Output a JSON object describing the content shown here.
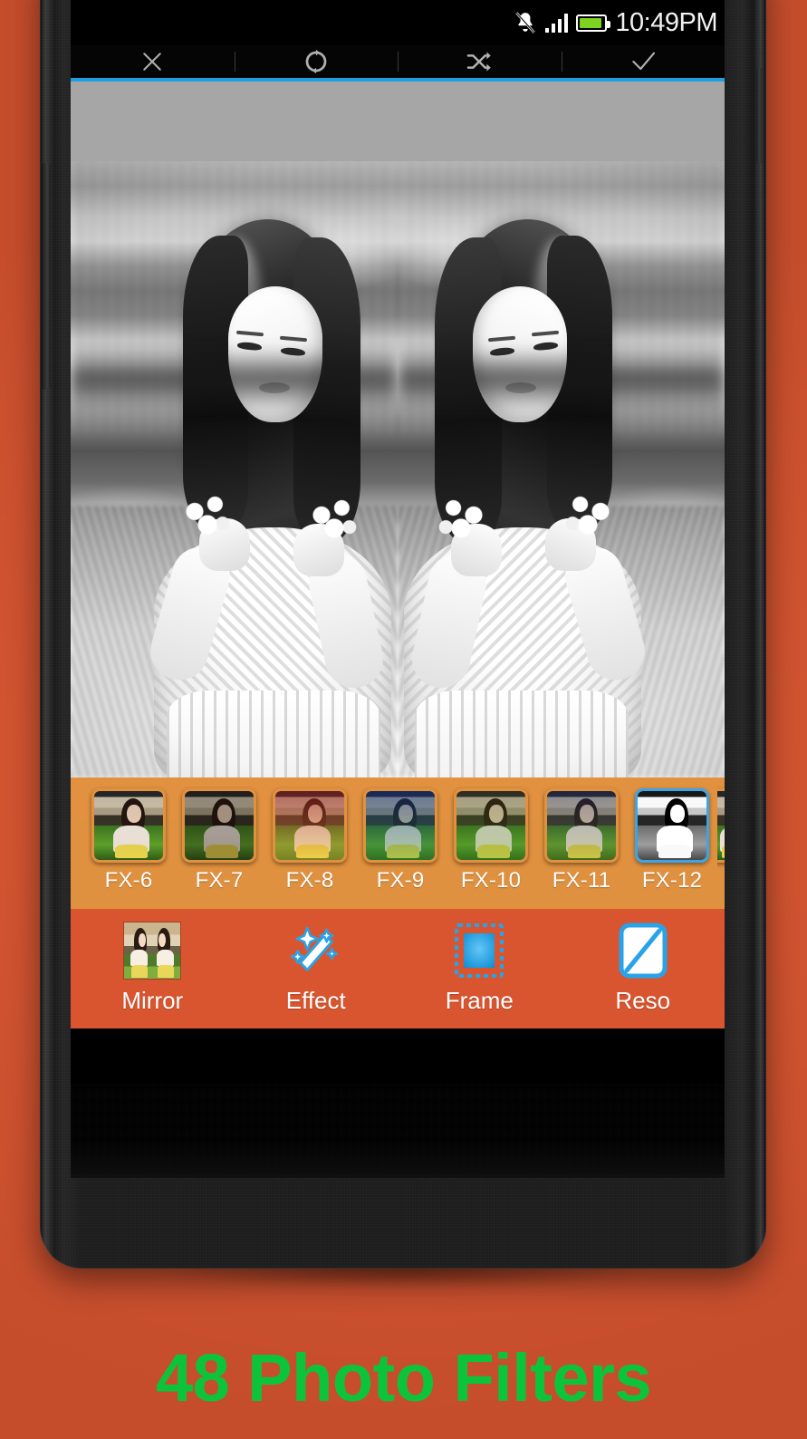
{
  "promo": {
    "caption": "48 Photo Filters",
    "caption_color": "#0cc43c",
    "background_color": "#d4572f"
  },
  "status_bar": {
    "time": "10:49PM",
    "icons": [
      "bell-mute-icon",
      "signal-bars-icon",
      "battery-icon"
    ],
    "battery_color": "#7ed321"
  },
  "action_bar": {
    "buttons": [
      {
        "name": "close-button",
        "icon": "close-icon",
        "label": "Close"
      },
      {
        "name": "rotate-button",
        "icon": "rotate-icon",
        "label": "Rotate"
      },
      {
        "name": "shuffle-button",
        "icon": "shuffle-icon",
        "label": "Shuffle"
      },
      {
        "name": "confirm-button",
        "icon": "check-icon",
        "label": "Done"
      }
    ],
    "accent_line_color": "#1ea0e0"
  },
  "canvas": {
    "mode": "mirror",
    "photo_description": "Black and white mirrored portrait of a woman in a white floral dress",
    "blank_panel_color": "#a6a6a6"
  },
  "filter_strip": {
    "background_color": "#e0913f",
    "selected_border_color": "#3aa5e8",
    "selected": "FX-12",
    "items": [
      {
        "label": "FX-6",
        "tint": "tint-fx6",
        "selected": false
      },
      {
        "label": "FX-7",
        "tint": "tint-fx7",
        "selected": false
      },
      {
        "label": "FX-8",
        "tint": "tint-fx8",
        "selected": false
      },
      {
        "label": "FX-9",
        "tint": "tint-fx9",
        "selected": false
      },
      {
        "label": "FX-10",
        "tint": "tint-fx10",
        "selected": false
      },
      {
        "label": "FX-11",
        "tint": "tint-fx11",
        "selected": false
      },
      {
        "label": "FX-12",
        "tint": "tint-fx12",
        "selected": true
      },
      {
        "label": "",
        "tint": "tint-fx6",
        "selected": false
      }
    ]
  },
  "bottom_toolbar": {
    "background_color": "#d9552f",
    "icon_color": "#2aa3e8",
    "items": [
      {
        "label": "Mirror",
        "icon": "mirror-thumbnail-icon"
      },
      {
        "label": "Effect",
        "icon": "magic-wand-icon"
      },
      {
        "label": "Frame",
        "icon": "frame-icon"
      },
      {
        "label": "Reso",
        "icon": "resolution-icon"
      }
    ]
  }
}
